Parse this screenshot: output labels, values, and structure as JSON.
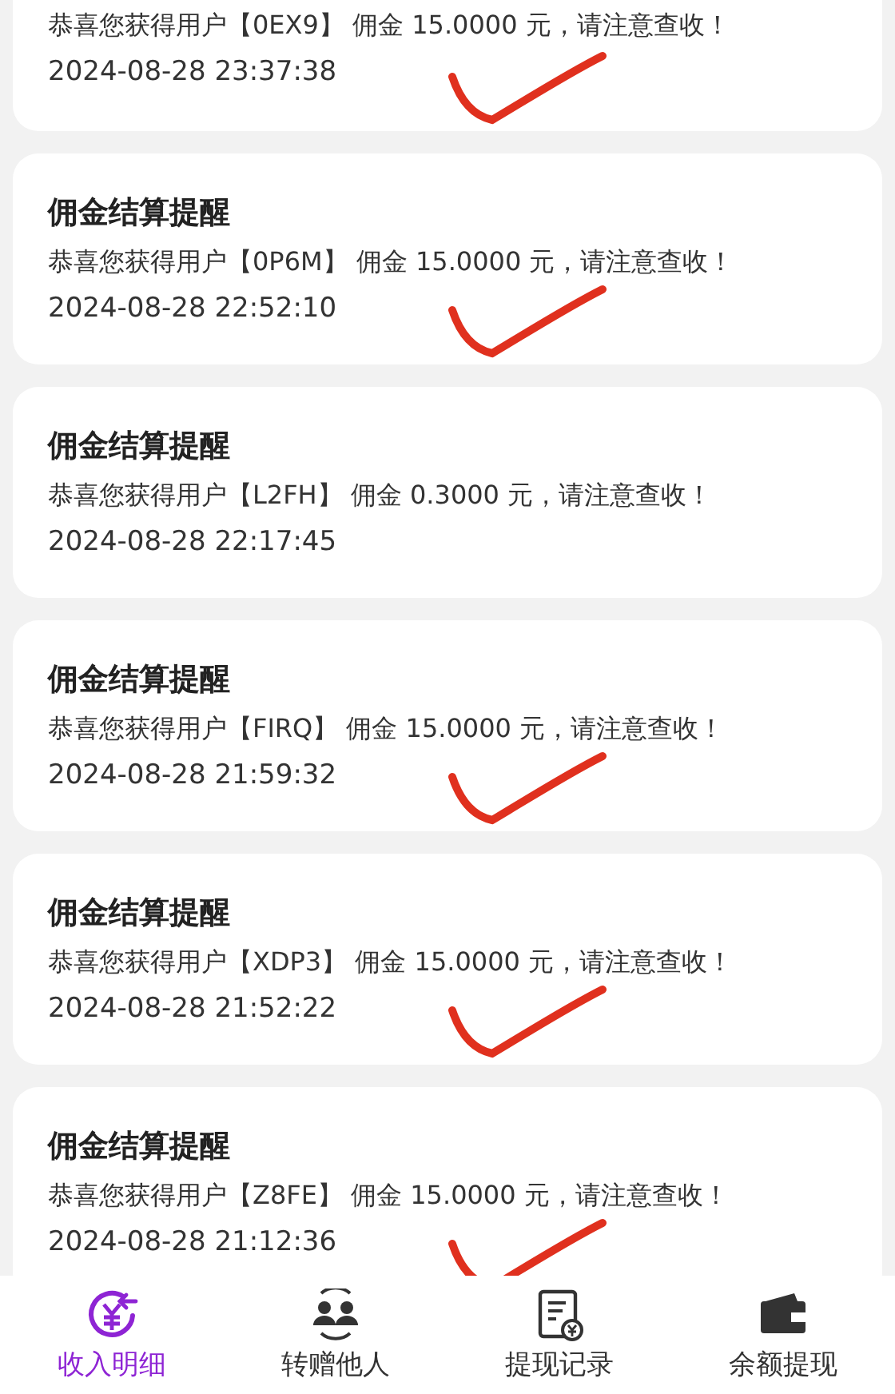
{
  "notifications": [
    {
      "message": "恭喜您获得用户【0EX9】 佣金 15.0000 元，请注意查收！",
      "time": "2024-08-28 23:37:38",
      "ticked": true
    },
    {
      "title": "佣金结算提醒",
      "message": "恭喜您获得用户【0P6M】 佣金 15.0000 元，请注意查收！",
      "time": "2024-08-28 22:52:10",
      "ticked": true
    },
    {
      "title": "佣金结算提醒",
      "message": "恭喜您获得用户【L2FH】 佣金 0.3000 元，请注意查收！",
      "time": "2024-08-28 22:17:45",
      "ticked": false
    },
    {
      "title": "佣金结算提醒",
      "message": "恭喜您获得用户【FIRQ】 佣金 15.0000 元，请注意查收！",
      "time": "2024-08-28 21:59:32",
      "ticked": true
    },
    {
      "title": "佣金结算提醒",
      "message": "恭喜您获得用户【XDP3】 佣金 15.0000 元，请注意查收！",
      "time": "2024-08-28 21:52:22",
      "ticked": true
    },
    {
      "title": "佣金结算提醒",
      "message": "恭喜您获得用户【Z8FE】 佣金 15.0000 元，请注意查收！",
      "time": "2024-08-28 21:12:36",
      "ticked": true
    }
  ],
  "bottom_nav": [
    {
      "label": "收入明细",
      "kind": "income",
      "selected": true
    },
    {
      "label": "转赠他人",
      "kind": "transfer",
      "selected": false
    },
    {
      "label": "提现记录",
      "kind": "records",
      "selected": false
    },
    {
      "label": "余额提现",
      "kind": "withdraw",
      "selected": false
    }
  ]
}
